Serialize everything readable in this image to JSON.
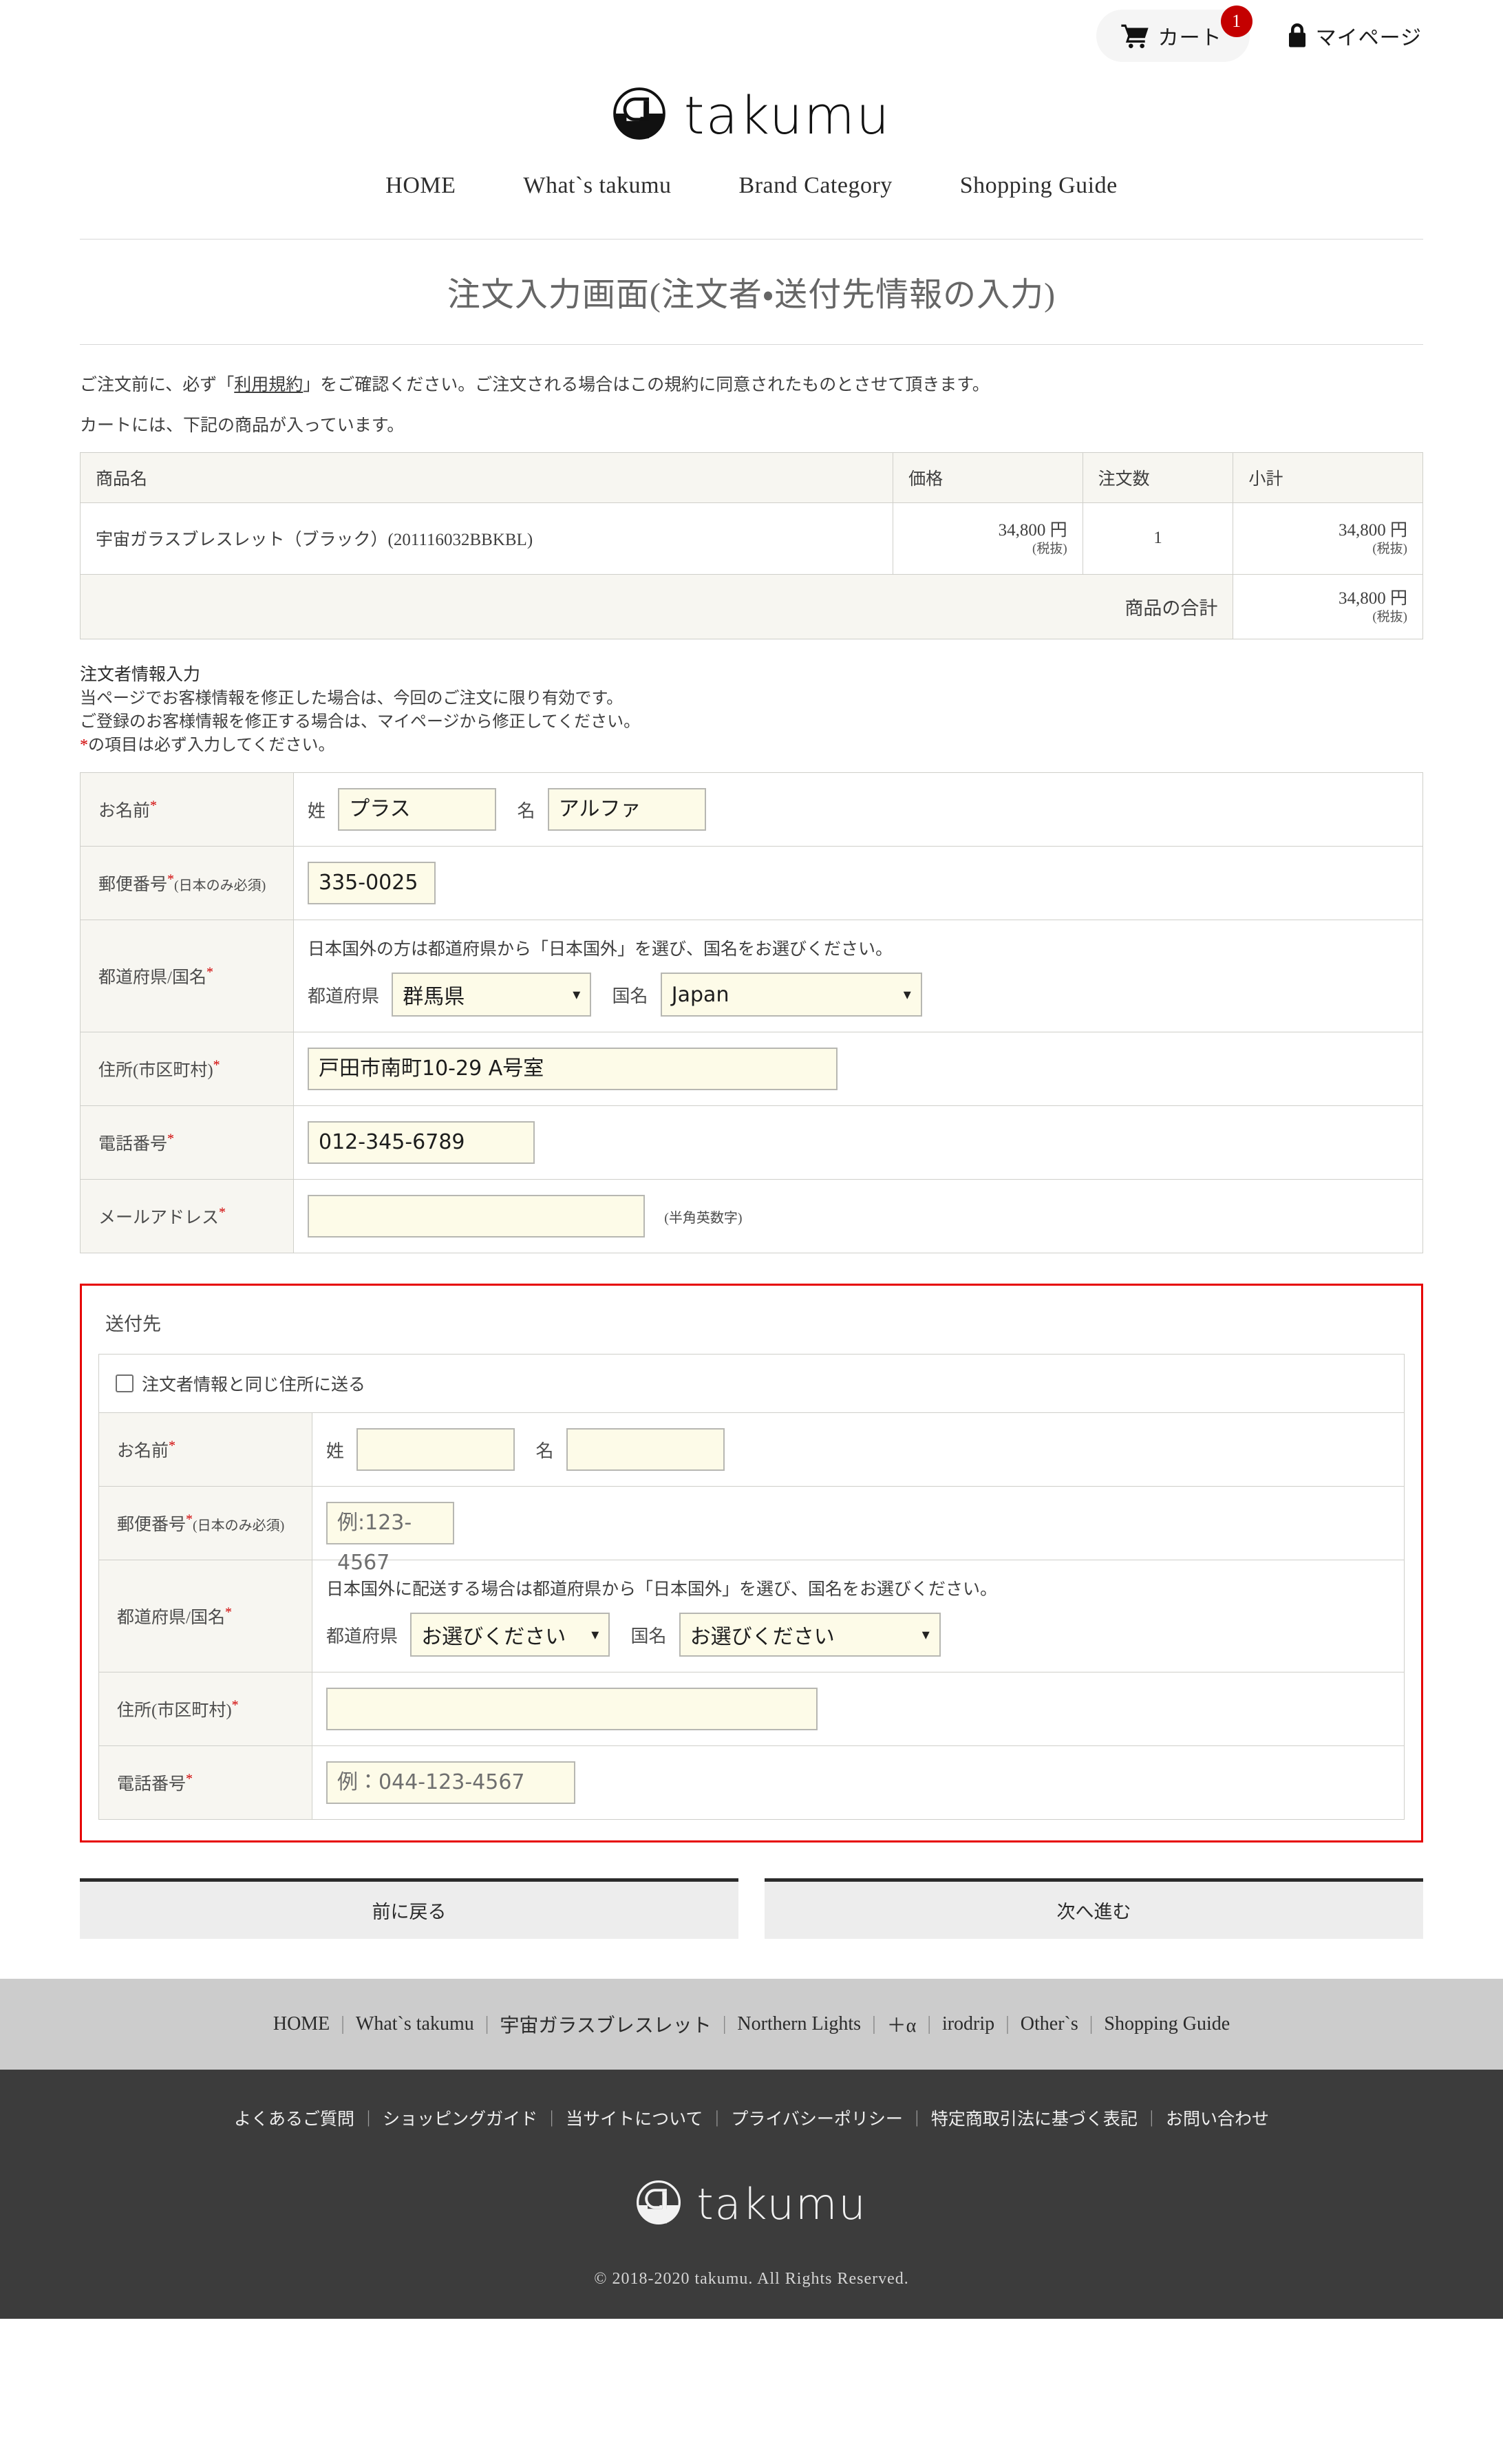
{
  "header": {
    "cart": {
      "label": "カート",
      "badge": "1",
      "icon": "cart-icon"
    },
    "mypage": {
      "label": "マイページ",
      "icon": "lock-icon"
    },
    "brand": "takumu",
    "nav": [
      {
        "label": "HOME"
      },
      {
        "label": "What`s takumu"
      },
      {
        "label": "Brand Category"
      },
      {
        "label": "Shopping Guide"
      }
    ]
  },
  "page": {
    "title": "注文入力画面(注文者・送付先情報の入力)",
    "intro_line1_before": "ご注文前に、必ず「",
    "intro_link": "利用規約",
    "intro_line1_after": "」をご確認ください。ご注文される場合はこの規約に同意されたものとさせて頂きます。",
    "intro_line2": "カートには、下記の商品が入っています。"
  },
  "cart_table": {
    "headers": [
      "商品名",
      "価格",
      "注文数",
      "小計"
    ],
    "rows": [
      {
        "name": "宇宙ガラスブレスレット（ブラック）(201116032BBKBL)",
        "price": "34,800 円",
        "price_tax_note": "(税抜)",
        "qty": "1",
        "subtotal": "34,800 円",
        "subtotal_tax_note": "(税抜)"
      }
    ],
    "total_label": "商品の合計",
    "total_value": "34,800 円",
    "total_tax_note": "(税抜)"
  },
  "orderer": {
    "heading": "注文者情報入力",
    "note1": "当ページでお客様情報を修正した場合は、今回のご注文に限り有効です。",
    "note2": "ご登録のお客様情報を修正する場合は、マイページから修正してください。",
    "note3_asterisk": "*",
    "note3": "の項目は必ず入力してください。",
    "fields": {
      "name_label": "お名前",
      "name_sei_label": "姓",
      "name_sei_value": "プラス",
      "name_mei_label": "名",
      "name_mei_value": "アルファ",
      "zip_label": "郵便番号",
      "zip_sub": "(日本のみ必須)",
      "zip_value": "335-0025",
      "pref_label": "都道府県/国名",
      "pref_note": "日本国外の方は都道府県から「日本国外」を選び、国名をお選びください。",
      "pref_sub_label": "都道府県",
      "pref_value": "群馬県",
      "country_sub_label": "国名",
      "country_value": "Japan",
      "address_label": "住所(市区町村)",
      "address_value": "戸田市南町10-29 A号室",
      "tel_label": "電話番号",
      "tel_value": "012-345-6789",
      "mail_label": "メールアドレス",
      "mail_value": "",
      "mail_hint": "(半角英数字)"
    }
  },
  "shipping": {
    "title": "送付先",
    "same_address_label": "注文者情報と同じ住所に送る",
    "same_address_checked": false,
    "fields": {
      "name_label": "お名前",
      "name_sei_label": "姓",
      "name_sei_value": "",
      "name_mei_label": "名",
      "name_mei_value": "",
      "zip_label": "郵便番号",
      "zip_sub": "(日本のみ必須)",
      "zip_placeholder": "例:123-4567",
      "pref_label": "都道府県/国名",
      "pref_note": "日本国外に配送する場合は都道府県から「日本国外」を選び、国名をお選びください。",
      "pref_sub_label": "都道府県",
      "pref_value": "お選びください",
      "country_sub_label": "国名",
      "country_value": "お選びください",
      "address_label": "住所(市区町村)",
      "address_value": "",
      "tel_label": "電話番号",
      "tel_placeholder": "例：044-123-4567"
    }
  },
  "actions": {
    "back_label": "前に戻る",
    "next_label": "次へ進む"
  },
  "footer": {
    "light_links": [
      "HOME",
      "What`s takumu",
      "宇宙ガラスブレスレット",
      "Northern Lights",
      "＋α",
      "irodrip",
      "Other`s",
      "Shopping Guide"
    ],
    "dark_links": [
      "よくあるご質問",
      "ショッピングガイド",
      "当サイトについて",
      "プライバシーポリシー",
      "特定商取引法に基づく表記",
      "お問い合わせ"
    ],
    "brand": "takumu",
    "copyright": "© 2018-2020 takumu. All Rights Reserved."
  },
  "colors": {
    "accent_red": "#e60000",
    "badge_red": "#c40000",
    "field_bg": "#fdfbe8",
    "header_bg": "#f7f6f1",
    "footer_dark": "#3c3c3c"
  }
}
